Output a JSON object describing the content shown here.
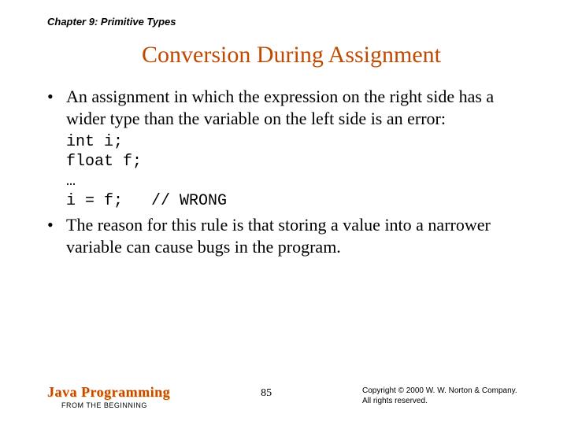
{
  "chapter": "Chapter 9: Primitive Types",
  "title": "Conversion During Assignment",
  "bullet1": "An assignment in which the expression on the right side has a wider type than the variable on the left side is an error:",
  "code": "int i;\nfloat f;\n…\ni = f;   // WRONG",
  "bullet2": "The reason for this rule is that storing a value into a narrower variable can cause bugs in the program.",
  "footer": {
    "brand": "Java Programming",
    "sub": "FROM THE BEGINNING",
    "page": "85",
    "copy1": "Copyright © 2000 W. W. Norton & Company.",
    "copy2": "All rights reserved."
  }
}
